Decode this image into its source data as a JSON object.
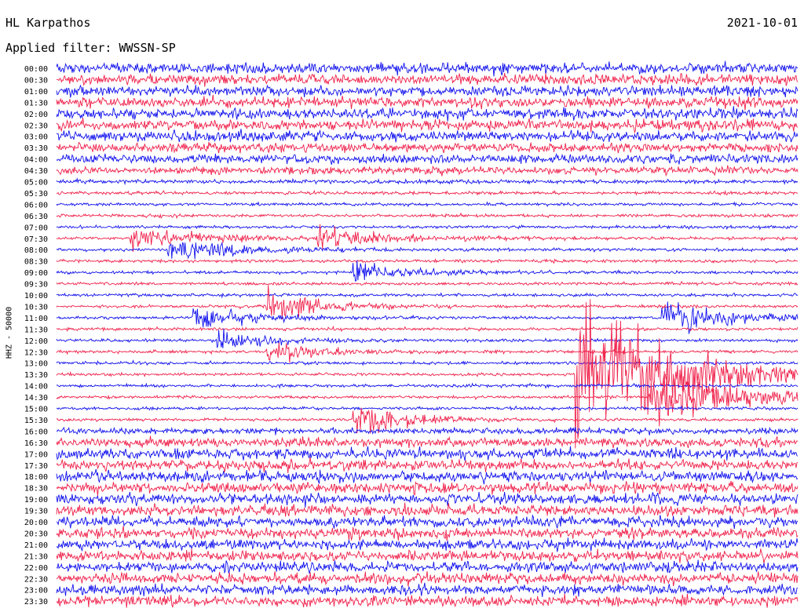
{
  "station": "HL Karpathos",
  "filter": "Applied filter: WWSSN-SP",
  "date": "2021-10-01",
  "channel_label": "HHZ - 50000",
  "colors": {
    "trace_a": "#1010ee",
    "trace_b": "#f0204a",
    "background": "#ffffff",
    "text": "#000000"
  },
  "chart_data": {
    "type": "helicorder",
    "title": "HL Karpathos",
    "subtitle": "Applied filter: WWSSN-SP",
    "date": "2021-10-01",
    "ylabel": "HHZ - 50000",
    "row_minutes": 30,
    "row_labels": [
      "00:00",
      "00:30",
      "01:00",
      "01:30",
      "02:00",
      "02:30",
      "03:00",
      "03:30",
      "04:00",
      "04:30",
      "05:00",
      "05:30",
      "06:00",
      "06:30",
      "07:00",
      "07:30",
      "08:00",
      "08:30",
      "09:00",
      "09:30",
      "10:00",
      "10:30",
      "11:00",
      "11:30",
      "12:00",
      "12:30",
      "13:00",
      "13:30",
      "14:00",
      "14:30",
      "15:00",
      "15:30",
      "16:00",
      "16:30",
      "17:00",
      "17:30",
      "18:00",
      "18:30",
      "19:00",
      "19:30",
      "20:00",
      "20:30",
      "21:00",
      "21:30",
      "22:00",
      "22:30",
      "23:00",
      "23:30"
    ],
    "noise_level": [
      3.5,
      3.5,
      3.5,
      3.5,
      3.5,
      3.5,
      3.5,
      3.0,
      3.0,
      2.5,
      1.3,
      1.1,
      1.0,
      1.0,
      1.0,
      1.0,
      1.0,
      1.0,
      1.0,
      1.0,
      1.0,
      1.0,
      1.0,
      1.0,
      1.0,
      1.0,
      1.0,
      1.0,
      1.0,
      1.0,
      1.0,
      1.0,
      2.0,
      3.0,
      3.5,
      3.5,
      3.5,
      3.5,
      3.5,
      3.5,
      3.5,
      3.5,
      3.5,
      3.5,
      3.5,
      3.5,
      3.5,
      3.5
    ],
    "events": [
      {
        "row": 16,
        "minute": 4.5,
        "amplitude": 12,
        "duration": 2.5
      },
      {
        "row": 15,
        "minute": 3.0,
        "amplitude": 10,
        "duration": 2.5
      },
      {
        "row": 15,
        "minute": 10.5,
        "amplitude": 9,
        "duration": 2.5
      },
      {
        "row": 18,
        "minute": 12.0,
        "amplitude": 10,
        "duration": 2.0
      },
      {
        "row": 21,
        "minute": 8.5,
        "amplitude": 14,
        "duration": 2.0
      },
      {
        "row": 22,
        "minute": 5.5,
        "amplitude": 12,
        "duration": 2.0
      },
      {
        "row": 22,
        "minute": 24.5,
        "amplitude": 15,
        "duration": 2.5
      },
      {
        "row": 22,
        "minute": 37.0,
        "amplitude": 10,
        "duration": 2.0
      },
      {
        "row": 23,
        "minute": 30.0,
        "amplitude": 18,
        "duration": 2.5
      },
      {
        "row": 23,
        "minute": 45.5,
        "amplitude": 15,
        "duration": 2.5
      },
      {
        "row": 24,
        "minute": 6.5,
        "amplitude": 10,
        "duration": 2.0
      },
      {
        "row": 24,
        "minute": 30.5,
        "amplitude": 12,
        "duration": 3.0
      },
      {
        "row": 25,
        "minute": 8.5,
        "amplitude": 10,
        "duration": 2.0
      },
      {
        "row": 27,
        "minute": 21.0,
        "amplitude": 70,
        "duration": 3.5
      },
      {
        "row": 30,
        "minute": 34.0,
        "amplitude": 16,
        "duration": 2.0
      },
      {
        "row": 31,
        "minute": 12.0,
        "amplitude": 14,
        "duration": 2.0
      },
      {
        "row": 29,
        "minute": 24.0,
        "amplitude": 30,
        "duration": 3.0
      },
      {
        "row": 29,
        "minute": 49.5,
        "amplitude": 20,
        "duration": 2.5
      },
      {
        "row": 27,
        "minute": 43.5,
        "amplitude": 22,
        "duration": 2.5
      },
      {
        "row": 32,
        "minute": 38.0,
        "amplitude": 12,
        "duration": 2.0
      },
      {
        "row": 19,
        "minute": 52.5,
        "amplitude": 15,
        "duration": 2.0
      },
      {
        "row": 20,
        "minute": 54.5,
        "amplitude": 14,
        "duration": 2.0
      },
      {
        "row": 13,
        "minute": 32.0,
        "amplitude": 20,
        "duration": 2.5
      },
      {
        "row": 7,
        "minute": 52.5,
        "amplitude": 25,
        "duration": 2.5
      },
      {
        "row": 11,
        "minute": 45.0,
        "amplitude": 15,
        "duration": 2.5
      },
      {
        "row": 26,
        "minute": 47.0,
        "amplitude": 20,
        "duration": 2.5
      }
    ]
  }
}
